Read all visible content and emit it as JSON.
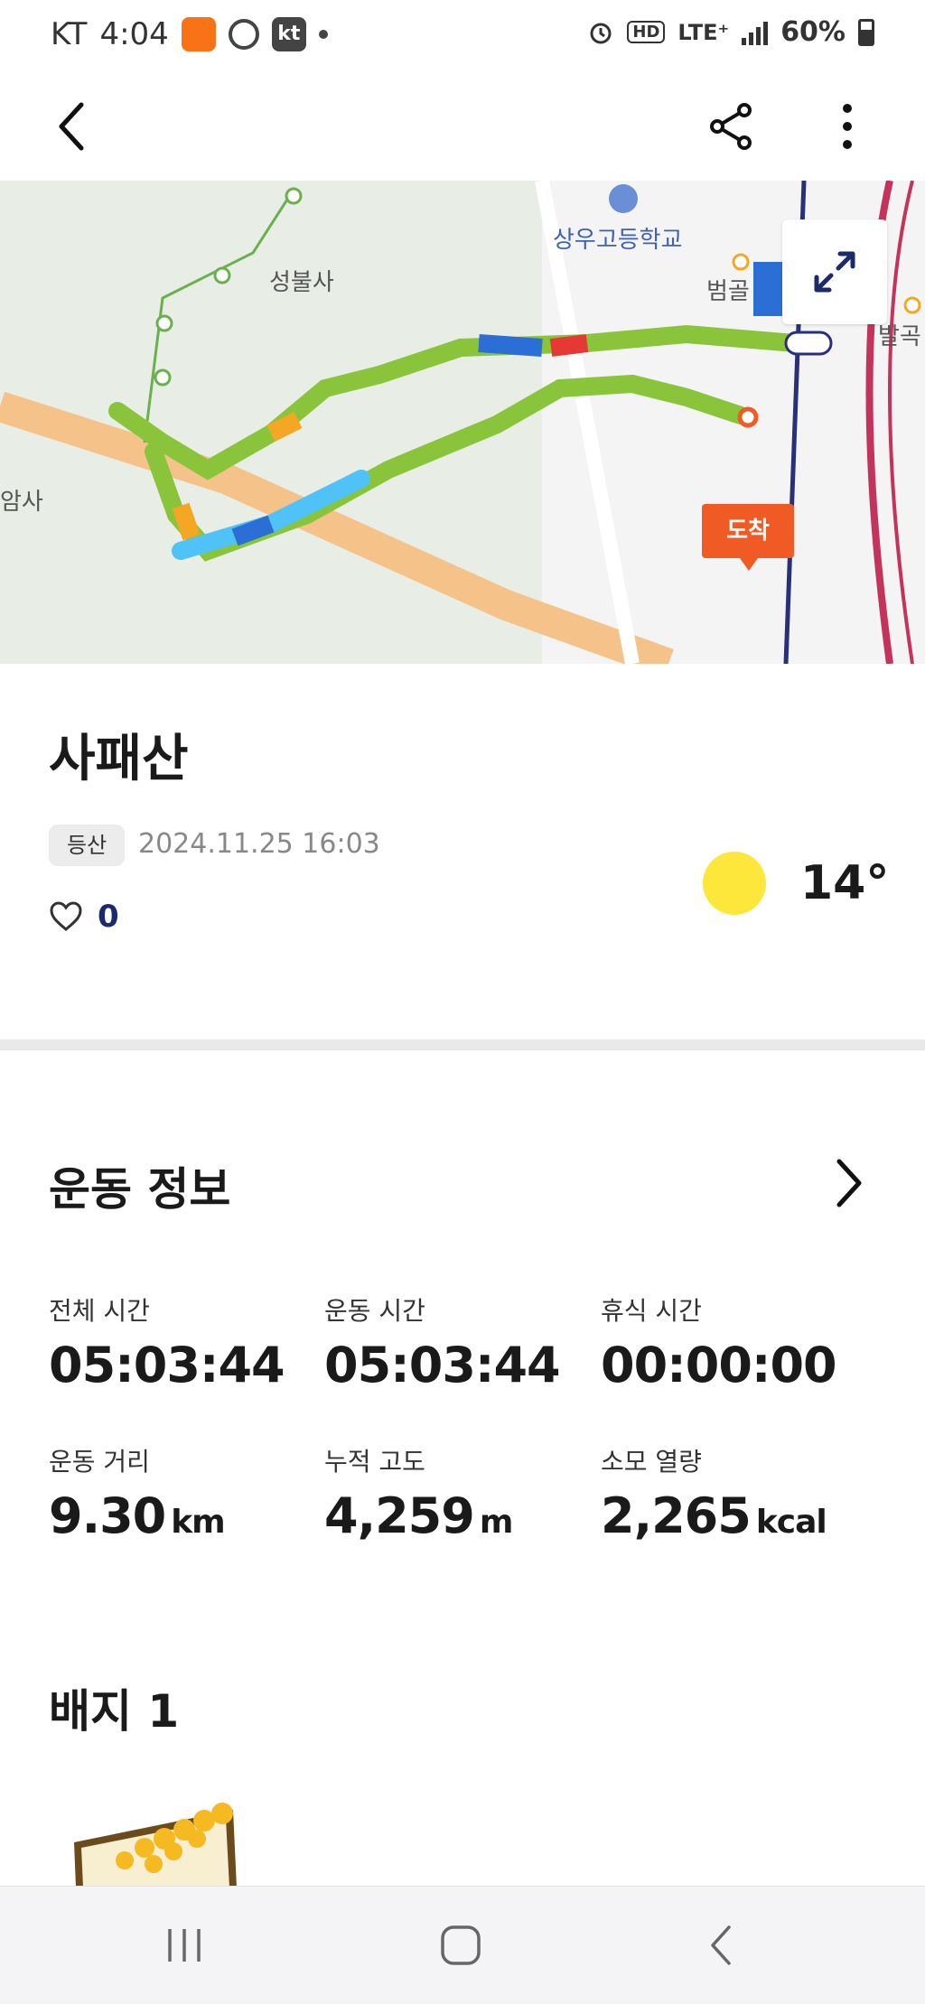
{
  "status_bar": {
    "carrier": "KT",
    "time": "4:04",
    "network": "LTE⁺",
    "battery": "60%",
    "hd": "HD",
    "kt_label": "kt"
  },
  "app_bar": {
    "back_icon": "chevron-left-icon",
    "share_icon": "share-icon",
    "more_icon": "more-vertical-icon"
  },
  "map": {
    "labels": {
      "school": "상우고등학교",
      "temple": "성불사",
      "area1": "범골",
      "area2": "발곡",
      "temple_partial": "암사"
    },
    "arrival_label": "도착",
    "expand_icon": "expand-icon"
  },
  "activity": {
    "title": "사패산",
    "type_tag": "등산",
    "datetime": "2024.11.25 16:03",
    "likes": "0",
    "weather_icon": "sun-icon",
    "temperature": "14°"
  },
  "exercise": {
    "section_title": "운동 정보",
    "stats": [
      {
        "label": "전체 시간",
        "value": "05:03:44",
        "unit": ""
      },
      {
        "label": "운동 시간",
        "value": "05:03:44",
        "unit": ""
      },
      {
        "label": "휴식 시간",
        "value": "00:00:00",
        "unit": ""
      },
      {
        "label": "운동 거리",
        "value": "9.30",
        "unit": "km"
      },
      {
        "label": "누적 고도",
        "value": "4,259",
        "unit": "m"
      },
      {
        "label": "소모 열량",
        "value": "2,265",
        "unit": "kcal"
      }
    ]
  },
  "badges": {
    "section_title": "배지 1"
  },
  "nav_bar": {
    "recents_icon": "recents-icon",
    "home_icon": "home-icon",
    "back_icon": "back-icon"
  },
  "colors": {
    "accent_orange": "#f05a24",
    "like_count": "#1b2a6b",
    "sun": "#fde73a"
  }
}
